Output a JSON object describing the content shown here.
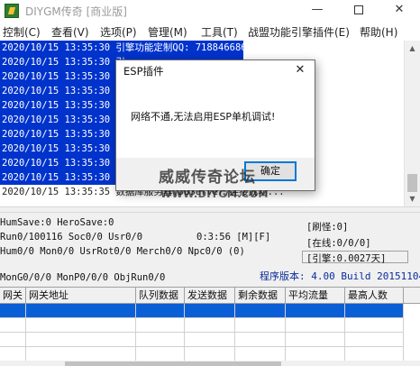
{
  "window": {
    "title": "DIYGM传奇 [商业版]",
    "minimize_glyph": "—",
    "close_glyph": "✕"
  },
  "menu": [
    "控制(C)",
    "查看(V)",
    "选项(P)",
    "管理(M)",
    "工具(T)",
    "战盟功能引擎插件(E)",
    "帮助(H)"
  ],
  "log": {
    "lines": [
      {
        "text": "2020/10/15 13:35:30 引擎功能定制QQ: 718846686",
        "selected": true
      },
      {
        "text": "2020/10/15 13:35:30 引",
        "selected": true
      },
      {
        "text": "2020/10/15 13:35:30 引",
        "selected": true
      },
      {
        "text": "2020/10/15 13:35:30 引",
        "selected": true
      },
      {
        "text": "2020/10/15 13:35:30 引",
        "selected": true
      },
      {
        "text": "2020/10/15 13:35:30 引",
        "selected": true
      },
      {
        "text": "2020/10/15 13:35:30 引",
        "selected": true
      },
      {
        "text": "2020/10/15 13:35:30 引",
        "selected": true
      },
      {
        "text": "2020/10/15 13:35:30 官",
        "selected": true
      },
      {
        "text": "2020/10/15 13:35:30 程",
        "selected": true
      },
      {
        "text": "2020/10/15 13:35:35 数据库服务器(DBServer)连接成功...",
        "selected": false
      }
    ]
  },
  "status": {
    "line1": "HumSave:0 HeroSave:0",
    "line2": "Run0/100116 Soc0/0 Usr0/0",
    "line2_time": "0:3:56 [M][F]",
    "line3": "Hum0/0 Mon0/0 UsrRot0/0 Merch0/0 Npc0/0 (0)",
    "line4": "MonG0/0/0 MonP0/0/0 ObjRun0/0",
    "refresh": "[刷怪:0]",
    "online": "[在线:0/0/0]",
    "engine": "[引擎:0.0027天]",
    "version": "程序版本: 4.00 Build 20151104"
  },
  "grid": {
    "headers": [
      "网关",
      "网关地址",
      "队列数据",
      "发送数据",
      "剩余数据",
      "平均流量",
      "最高人数"
    ]
  },
  "dialog": {
    "title": "ESP插件",
    "message": "网络不通,无法启用ESP单机调试!",
    "ok_label": "确定",
    "close_glyph": "✕"
  },
  "watermark": {
    "text": "威威传奇论坛",
    "url": "WWW.DIYGM.COM"
  },
  "colors": {
    "selection": "#0033cc",
    "row_selection": "#0b5fd6",
    "version_text": "#0b2d9a"
  }
}
